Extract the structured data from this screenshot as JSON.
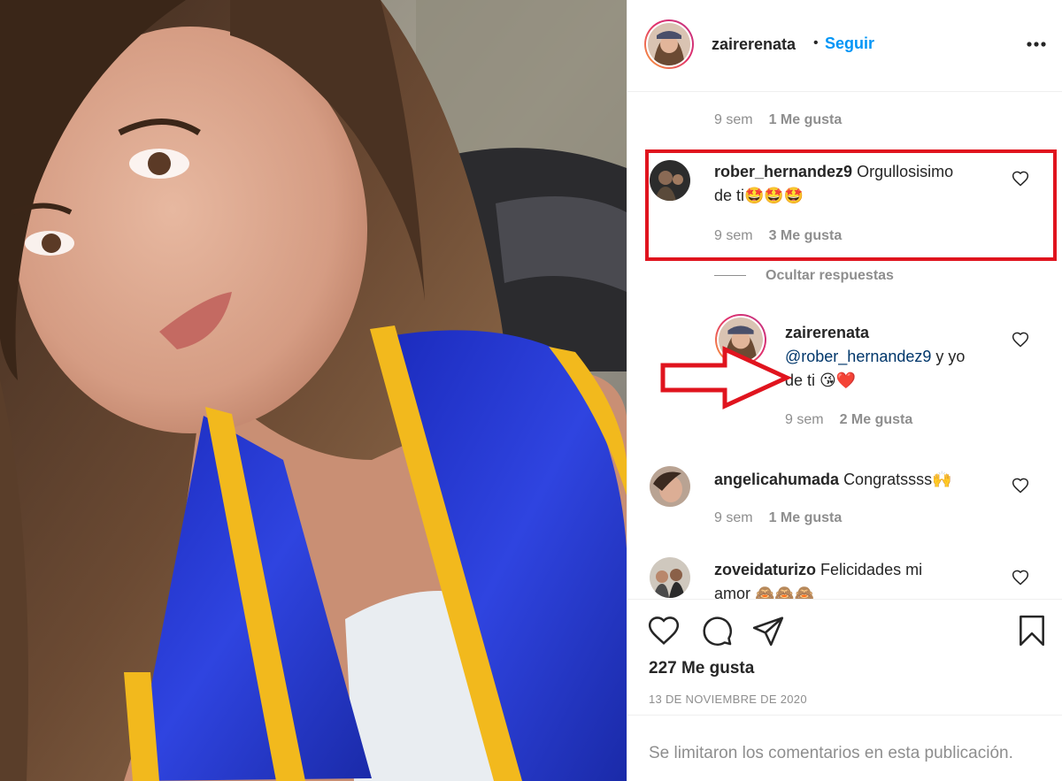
{
  "post": {
    "username": "zairerenata",
    "separator": "•",
    "follow_label": "Seguir",
    "more_icon": "more-options-icon"
  },
  "comments": {
    "top_meta": {
      "time": "9 sem",
      "likes": "1 Me gusta"
    },
    "items": [
      {
        "username": "rober_hernandez9",
        "text_line1": "Orgullosisimo",
        "text_line2": "de ti🤩🤩🤩",
        "time": "9 sem",
        "likes": "3 Me gusta"
      },
      {
        "username": "angelicahumada",
        "text": "Congratssss🙌",
        "time": "9 sem",
        "likes": "1 Me gusta"
      },
      {
        "username": "zoveidaturizo",
        "text": "Felicidades mi",
        "text_line2": "amor 🙈🙈🙈"
      }
    ],
    "hide_replies_label": "Ocultar respuestas",
    "reply": {
      "username": "zairerenata",
      "mention": "@rober_hernandez9",
      "text_after_mention": " y yo",
      "text_line2": "de ti 😘❤️",
      "time": "9 sem",
      "likes": "2 Me gusta"
    },
    "highlight_color": "#e0141e"
  },
  "actions": {
    "icons": [
      "heart-icon",
      "comment-icon",
      "share-icon",
      "bookmark-icon"
    ],
    "like_count": "227 Me gusta",
    "date": "13 DE NOVIEMBRE DE 2020"
  },
  "footer": {
    "comments_limited": "Se limitaron los comentarios en esta publicación."
  },
  "colors": {
    "follow_blue": "#0095f6",
    "mention_blue": "#00376b",
    "secondary_text": "#8e8e8e",
    "stole_blue": "#1f2fc4",
    "stole_gold": "#f2b91d"
  }
}
